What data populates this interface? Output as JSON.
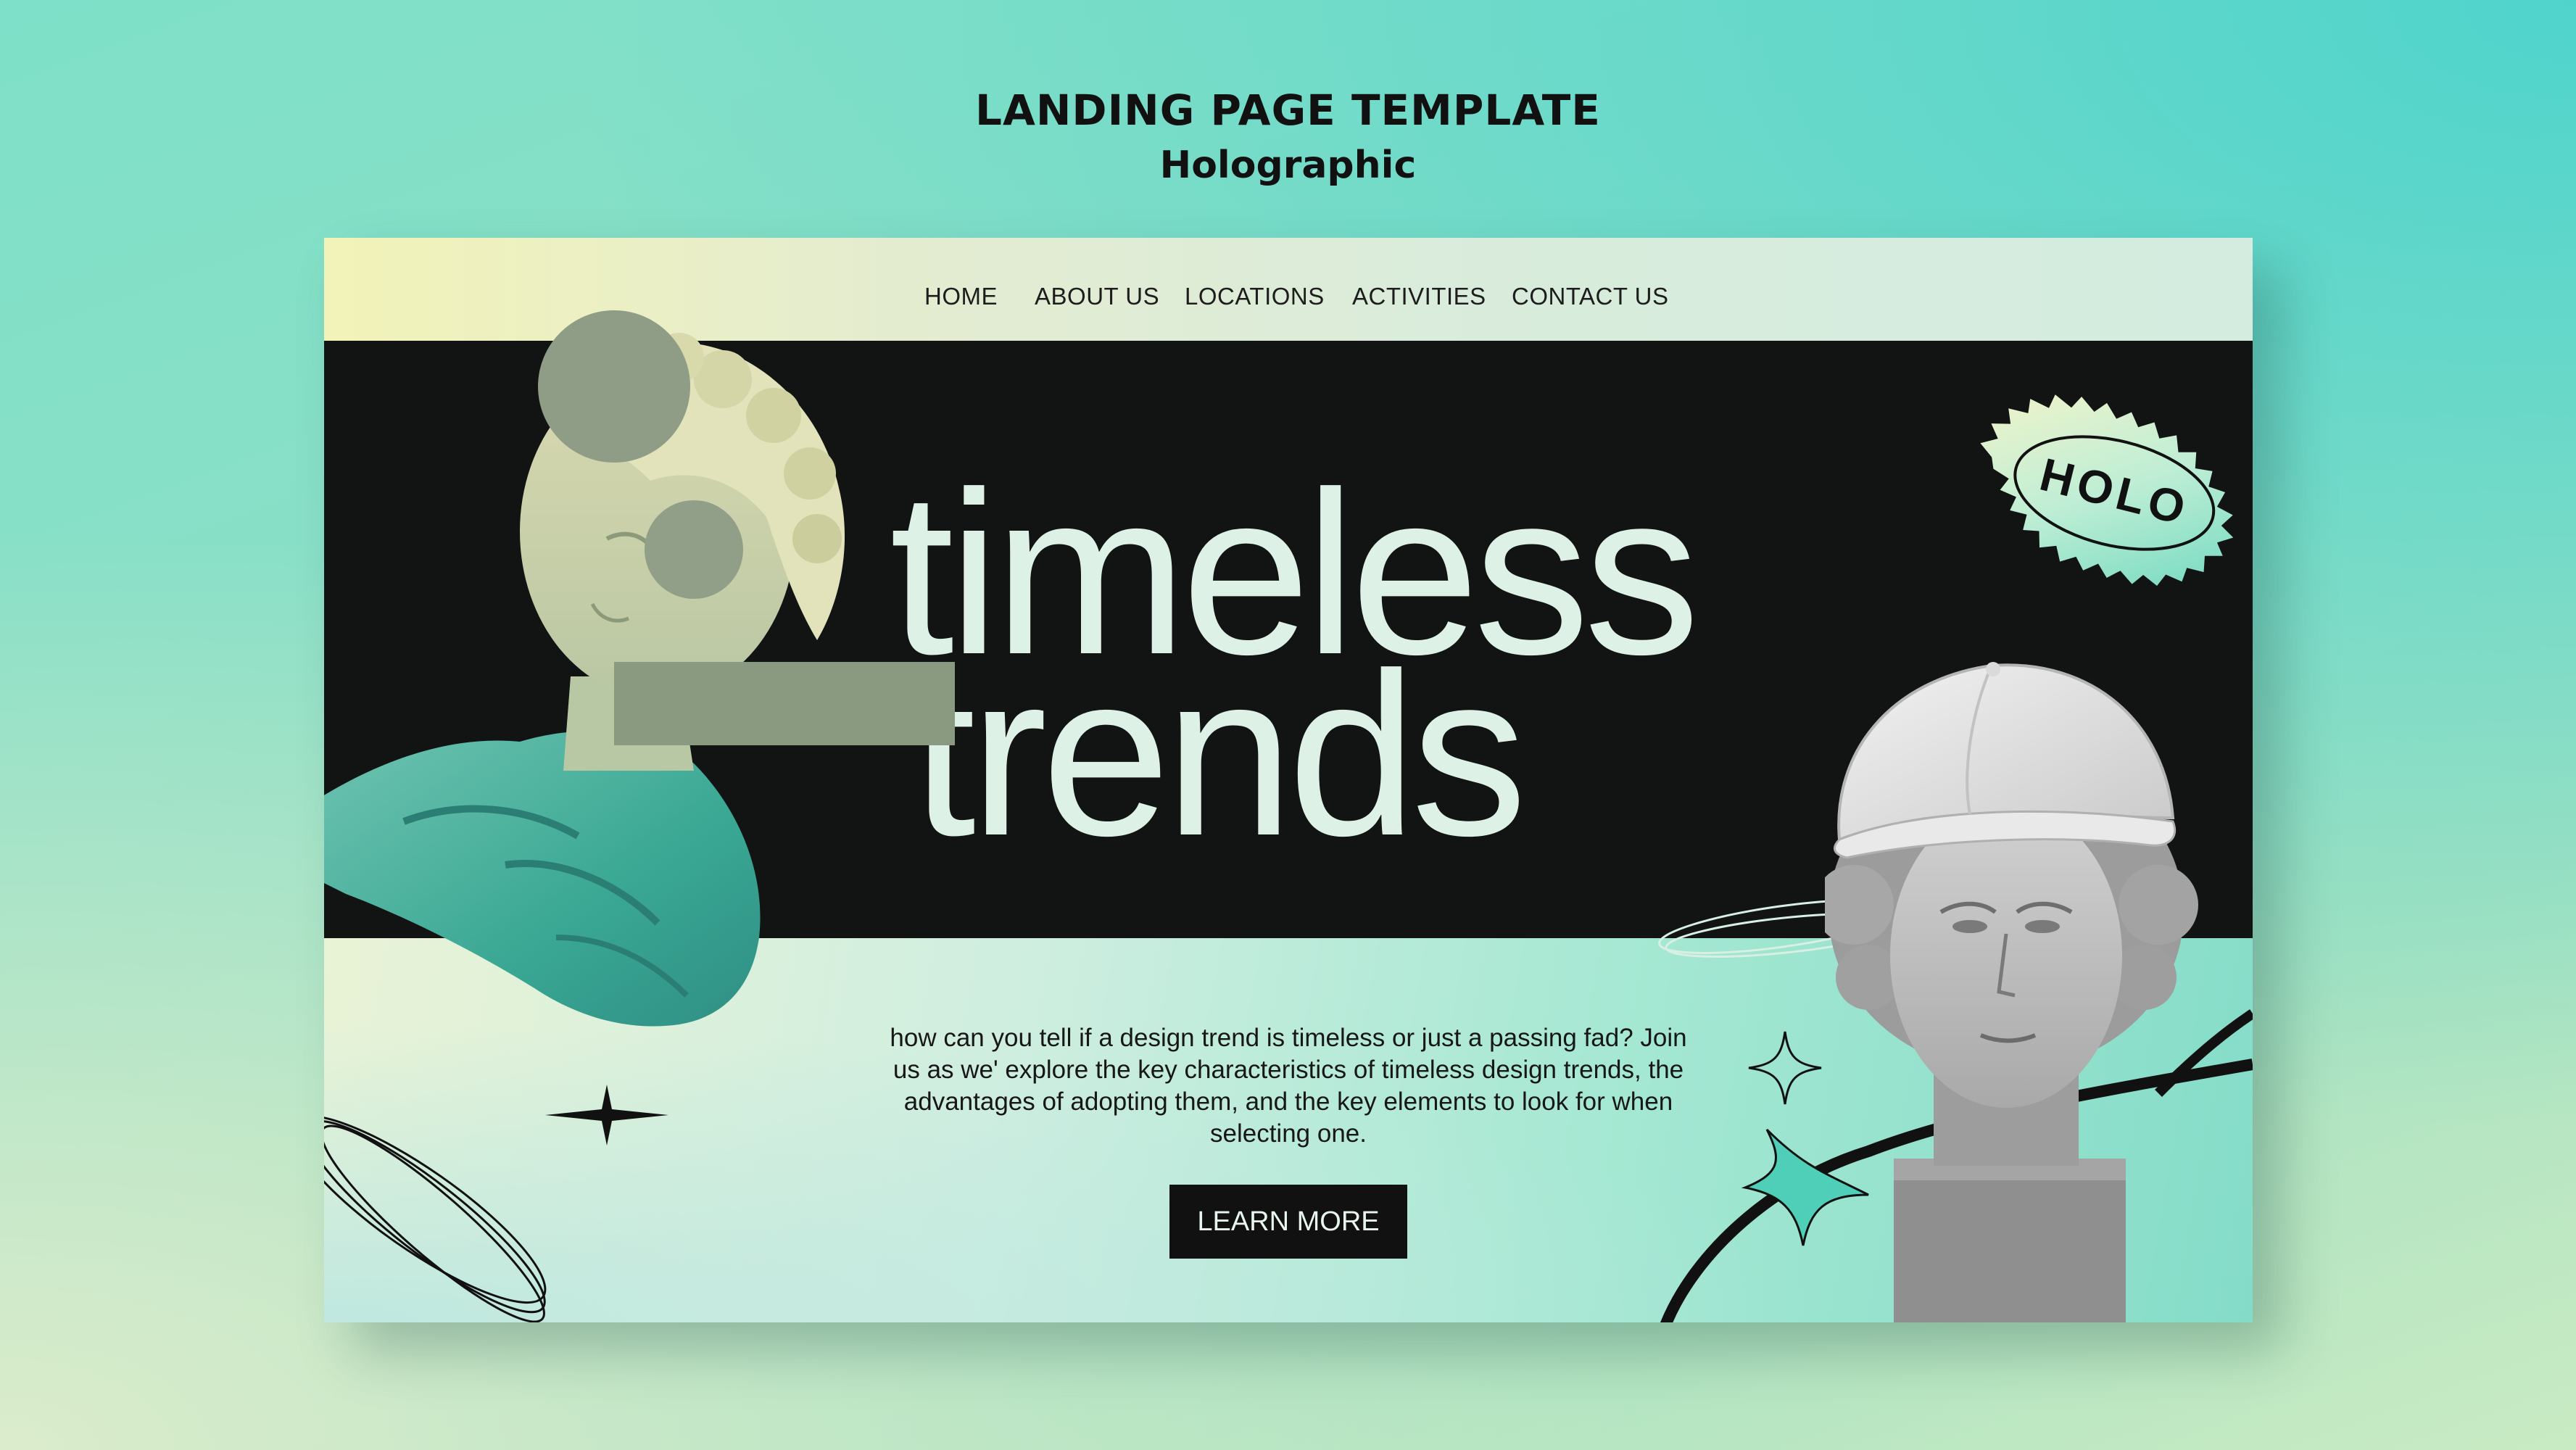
{
  "heading": {
    "title": "LANDING PAGE TEMPLATE",
    "subtitle": "Holographic"
  },
  "nav": {
    "items": [
      {
        "label": "HOME"
      },
      {
        "label": "ABOUT US"
      },
      {
        "label": "LOCATIONS"
      },
      {
        "label": "ACTIVITIES"
      },
      {
        "label": "CONTACT US"
      }
    ]
  },
  "hero": {
    "line1": "timeless",
    "line2": "trends"
  },
  "badge": {
    "text": "HOLO"
  },
  "content": {
    "body": "how can you tell if a design trend is timeless or just a passing fad? Join us as we' explore the key characteristics of timeless design trends, the advantages of adopting them, and the key elements to look for when selecting one.",
    "button_label": "LEARN MORE"
  },
  "colors": {
    "hero_bg": "#121313",
    "hero_text": "#ddf1e6",
    "button_bg": "#111111",
    "accent_teal": "#3fb3a3"
  }
}
